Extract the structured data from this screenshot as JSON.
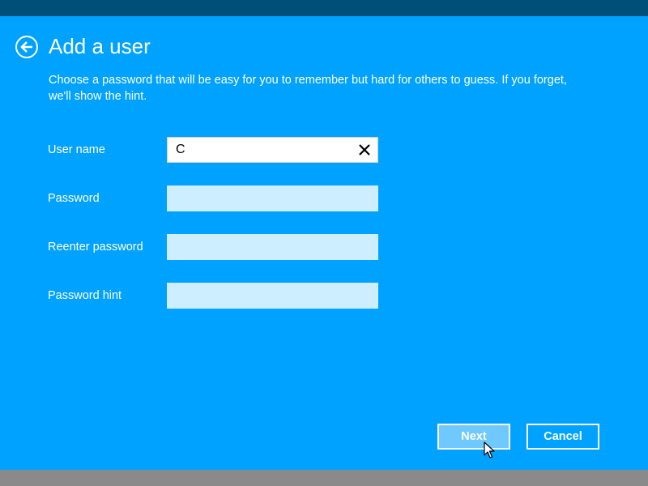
{
  "header": {
    "title": "Add a user",
    "back_icon": "back-arrow-icon"
  },
  "description": "Choose a password that will be easy for you to remember but hard for others to guess. If you forget, we'll show the hint.",
  "form": {
    "user_name": {
      "label": "User name",
      "value": "C"
    },
    "password": {
      "label": "Password",
      "value": ""
    },
    "reenter_password": {
      "label": "Reenter password",
      "value": ""
    },
    "password_hint": {
      "label": "Password hint",
      "value": ""
    }
  },
  "buttons": {
    "next": "Next",
    "cancel": "Cancel"
  },
  "colors": {
    "background": "#00a2ff",
    "top_strip": "#004f78",
    "bottom_strip": "#8a8a8a",
    "field_inactive": "#cceeff",
    "next_button_hover": "#6fc9ff"
  }
}
